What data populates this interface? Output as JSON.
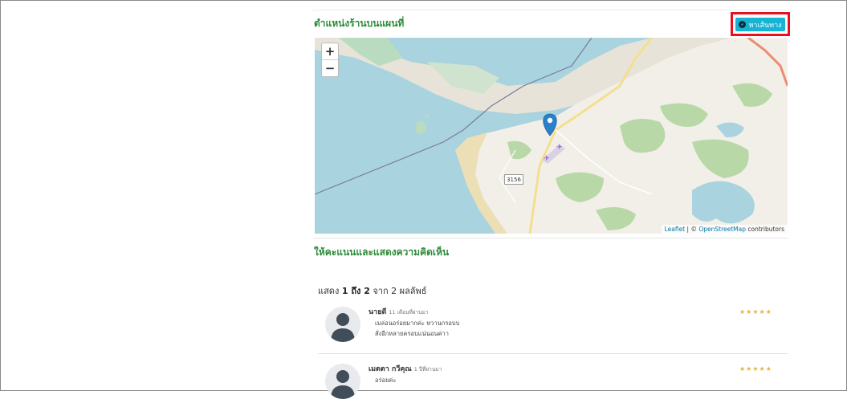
{
  "map_section": {
    "title": "ตำแหน่งร้านบนแผนที่",
    "route_button": {
      "label": "หาเส้นทาง",
      "icon": "compass-icon",
      "highlight_color": "#e8101e",
      "bg_color": "#17b3d3"
    },
    "zoom_in": "+",
    "zoom_out": "−",
    "road_label": "3156",
    "attribution": {
      "leaflet": "Leaflet",
      "sep": " | © ",
      "osm": "OpenStreetMap",
      "suffix": " contributors"
    }
  },
  "rating_section": {
    "title": "ให้คะแนนและแสดงความคิดเห็น",
    "results": {
      "prefix": "แสดง ",
      "from": "1",
      "to_word": " ถึง ",
      "to": "2",
      "of_word": " จาก ",
      "total": "2",
      "suffix": " ผลลัพธ์"
    }
  },
  "reviews": [
    {
      "name": "นายดี",
      "time": "11 เดือนที่ผ่านมา",
      "lines": [
        "เมล่อนอร่อยมากค่ะ หวานกรอบบ",
        "สั่งอีกหลายครอบแน่นอนค่าา"
      ],
      "stars": "★★★★★",
      "rating": 5
    },
    {
      "name": "เมตตา กวีคุณ",
      "time": "1 ปีที่ผ่านมา",
      "lines": [
        "อร่อยค่ะ"
      ],
      "stars": "★★★★★",
      "rating": 5
    }
  ],
  "colors": {
    "heading_green": "#2e8b3a",
    "star_gold": "#e0b53d",
    "water": "#a9d3df",
    "land": "#f2efe9"
  }
}
